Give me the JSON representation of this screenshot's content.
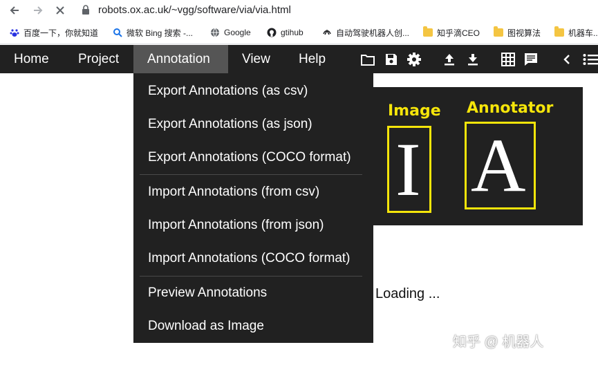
{
  "browser": {
    "url": "robots.ox.ac.uk/~vgg/software/via/via.html",
    "bookmarks": [
      {
        "label": "百度一下，你就知道",
        "icon": "baidu-paw-icon"
      },
      {
        "label": "微软 Bing 搜索 -...",
        "icon": "search-icon"
      },
      {
        "label": "Google",
        "icon": "globe-icon"
      },
      {
        "label": "gtihub",
        "icon": "github-icon"
      },
      {
        "label": "自动驾驶机器人创...",
        "icon": "bookmark-site-icon"
      },
      {
        "label": "知乎滴CEO",
        "icon": "folder-icon"
      },
      {
        "label": "图视算法",
        "icon": "folder-icon"
      },
      {
        "label": "机器车...",
        "icon": "folder-icon"
      }
    ]
  },
  "topbar": {
    "menu": [
      "Home",
      "Project",
      "Annotation",
      "View",
      "Help"
    ],
    "active": "Annotation",
    "icons": [
      "folder-open-icon",
      "save-icon",
      "settings-icon",
      "upload-icon",
      "download-icon",
      "grid-icon",
      "comment-icon",
      "chevron-left-icon",
      "list-icon"
    ]
  },
  "dropdown": {
    "items": [
      "Export Annotations (as csv)",
      "Export Annotations (as json)",
      "Export Annotations (COCO format)",
      "Import Annotations (from csv)",
      "Import Annotations (from json)",
      "Import Annotations (COCO format)",
      "Preview Annotations",
      "Download as Image"
    ]
  },
  "logo": {
    "word_image": "Image",
    "word_annotator": "Annotator",
    "letter_i": "I",
    "letter_a": "A",
    "accent": "#f5e50a"
  },
  "status": {
    "loading": "Loading ..."
  },
  "watermark": "知乎 @ 机器人"
}
